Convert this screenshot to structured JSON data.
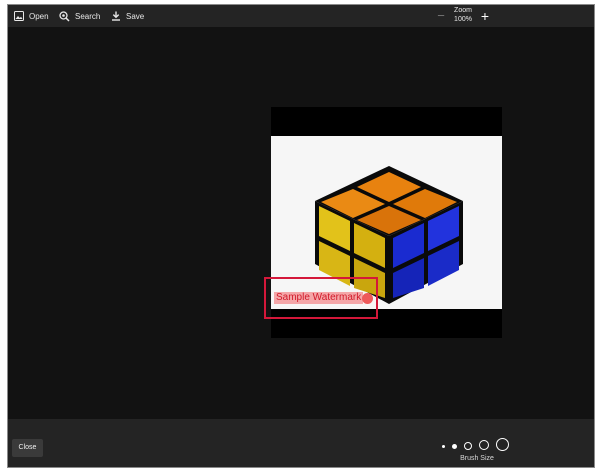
{
  "toolbar": {
    "open_label": "Open",
    "search_label": "Search",
    "save_label": "Save",
    "zoom_label": "Zoom",
    "zoom_value": "100%",
    "zoom_minus": "−",
    "zoom_plus": "+"
  },
  "canvas": {
    "watermark_text": "Sample Watermark",
    "colors": {
      "selection_border": "#d4183a",
      "watermark_highlight": "#f4a6a8",
      "watermark_text": "#d11a2a",
      "cube_orange": "#e8820f",
      "cube_yellow": "#e2c21a",
      "cube_blue": "#1a2bd0"
    }
  },
  "footer": {
    "close_label": "Close",
    "brush_size_label": "Brush Size",
    "brush_sizes": [
      "xs",
      "s",
      "m",
      "l",
      "xl"
    ]
  }
}
